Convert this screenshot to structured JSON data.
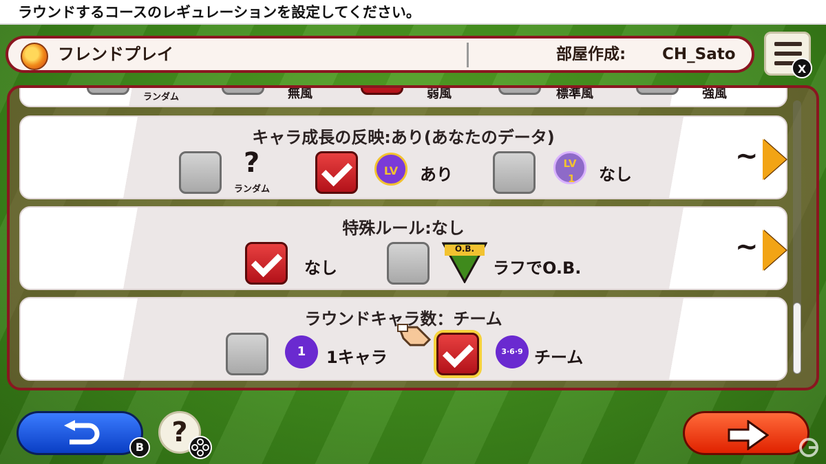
{
  "instruction": "ラウンドするコースのレギュレーションを設定してください。",
  "header": {
    "title": "フレンドプレイ",
    "room_label": "部屋作成:",
    "room_value": "CH_Sato"
  },
  "menu": {
    "badge": "X"
  },
  "rows": {
    "wind": {
      "options": [
        "ランダム",
        "無風",
        "弱風",
        "標準風",
        "強風"
      ],
      "selected": "弱風"
    },
    "growth": {
      "title": "キャラ成長の反映:あり(あなたのデータ)",
      "opt_random_glyph": "?",
      "opt_random_label": "ランダム",
      "opt_on_label": "あり",
      "opt_on_icon_text": "LV",
      "opt_off_label": "なし",
      "opt_off_icon_text": "LV",
      "opt_off_icon_sub": "1",
      "selected": "あり"
    },
    "special": {
      "title": "特殊ルール:なし",
      "opt_none_label": "なし",
      "opt_rough_label": "ラフでO.B.",
      "opt_rough_icon_text": "O.B.",
      "selected": "なし"
    },
    "chars": {
      "title": "ラウンドキャラ数：チーム",
      "opt_one_label": "1キャラ",
      "opt_one_icon_text": "1",
      "opt_team_label": "チーム",
      "opt_team_icon_text": "3·6·9",
      "selected": "チーム"
    },
    "more_indicator": "~"
  },
  "footer": {
    "back_badge": "B",
    "help_glyph": "?"
  },
  "colors": {
    "frame": "#8a1620",
    "checked": "#c8161f",
    "back_button": "#1448e0",
    "next_button": "#f03a10",
    "arrow": "#f2a415"
  }
}
